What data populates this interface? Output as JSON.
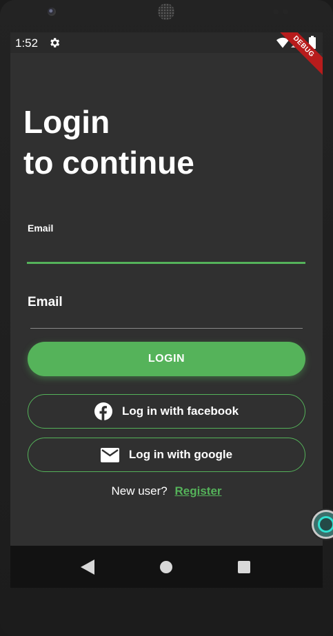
{
  "status_bar": {
    "time": "1:52",
    "icons": [
      "gear-icon",
      "wifi-icon",
      "cell-signal-icon",
      "battery-icon"
    ]
  },
  "debug_banner": "DEBUG",
  "headline": {
    "line1": "Login",
    "line2": "to continue"
  },
  "email_field_1": {
    "label": "Email",
    "value": ""
  },
  "email_field_2": {
    "label": "Email",
    "value": ""
  },
  "login_button": "LOGIN",
  "facebook_button": {
    "label": "Log in with facebook",
    "icon": "facebook-icon"
  },
  "google_button": {
    "label": "Log in with google",
    "icon": "mail-icon"
  },
  "register": {
    "prompt": "New user?",
    "link": "Register"
  },
  "colors": {
    "accent": "#55b35a",
    "background": "#303030",
    "nav_bar": "#121212",
    "debug_banner": "#b71c1c"
  }
}
